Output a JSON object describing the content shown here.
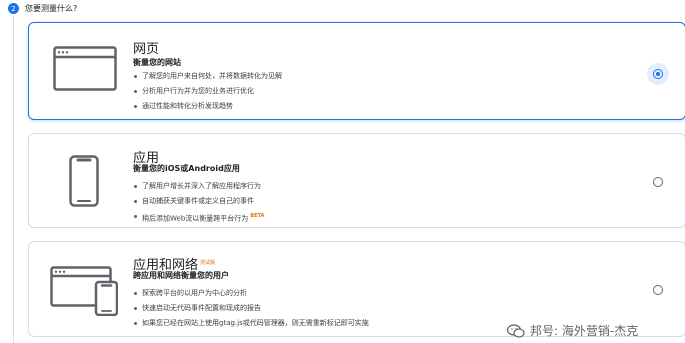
{
  "step": {
    "number": "2",
    "title": "您要测量什么?"
  },
  "options": [
    {
      "title": "网页",
      "subtitle": "衡量您的网站",
      "bullets": [
        "了解您的用户来自何处，并将数据转化为见解",
        "分析用户行为并为您的业务进行优化",
        "通过性能和转化分析发现趋势"
      ],
      "selected": true,
      "icon": "browser-window-icon"
    },
    {
      "title": "应用",
      "subtitle": "衡量您的iOS或Android应用",
      "bullets": [
        "了解用户增长并深入了解应用程序行为",
        "自动捕获关键事件或定义自己的事件",
        "稍后添加Web流以衡量跨平台行为"
      ],
      "beta": "BETA",
      "selected": false,
      "icon": "mobile-phone-icon"
    },
    {
      "title": "应用和网络",
      "title_badge": "测试版",
      "subtitle": "跨应用和网络衡量您的用户",
      "bullets": [
        "探索跨平台的以用户为中心的分析",
        "快速启动无代码事件配置和现成的报告",
        "如果您已经在网站上使用gtag.js或代码管理器，则无需重新标记即可实施"
      ],
      "selected": false,
      "icon": "browser-and-phone-icon"
    }
  ],
  "watermark": {
    "text": "邦号: 海外营销-杰克",
    "icon": "wechat-icon"
  },
  "colors": {
    "accent": "#1a73e8",
    "beta": "#e8710a",
    "border": "#dadce0"
  }
}
